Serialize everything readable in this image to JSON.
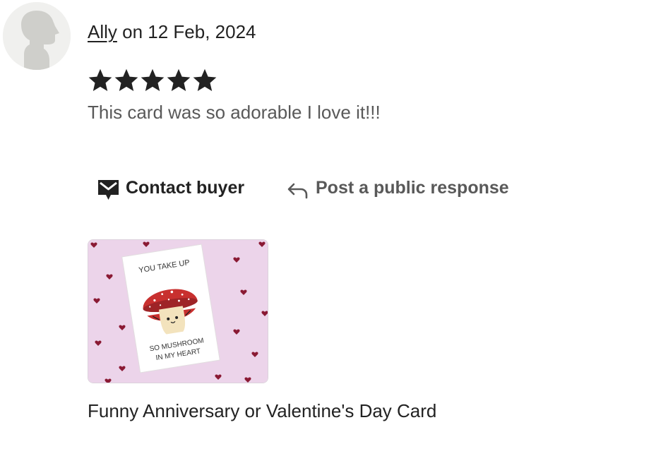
{
  "review": {
    "reviewer_name": "Ally",
    "date_text": " on 12 Feb, 2024",
    "rating": 5,
    "rating_max": 5,
    "text": "This card was so adorable I love it!!!"
  },
  "actions": {
    "contact_label": "Contact buyer",
    "contact_icon": "envelope-icon",
    "respond_label": "Post a public response",
    "respond_icon": "reply-arrow-icon"
  },
  "listing": {
    "title": "Funny Anniversary or Valentine's Day Card",
    "card_text_top": "YOU TAKE UP",
    "card_text_bottom_1": "SO MUSHROOM",
    "card_text_bottom_2": "IN MY HEART"
  },
  "colors": {
    "text_primary": "#222222",
    "text_secondary": "#595959",
    "star": "#222222",
    "avatar_bg": "#f0f0ee",
    "avatar_silhouette": "#cfcfcb",
    "thumb_background": "#ecd4ea",
    "mushroom_cap": "#c8302f",
    "heart": "#8a1a34"
  }
}
